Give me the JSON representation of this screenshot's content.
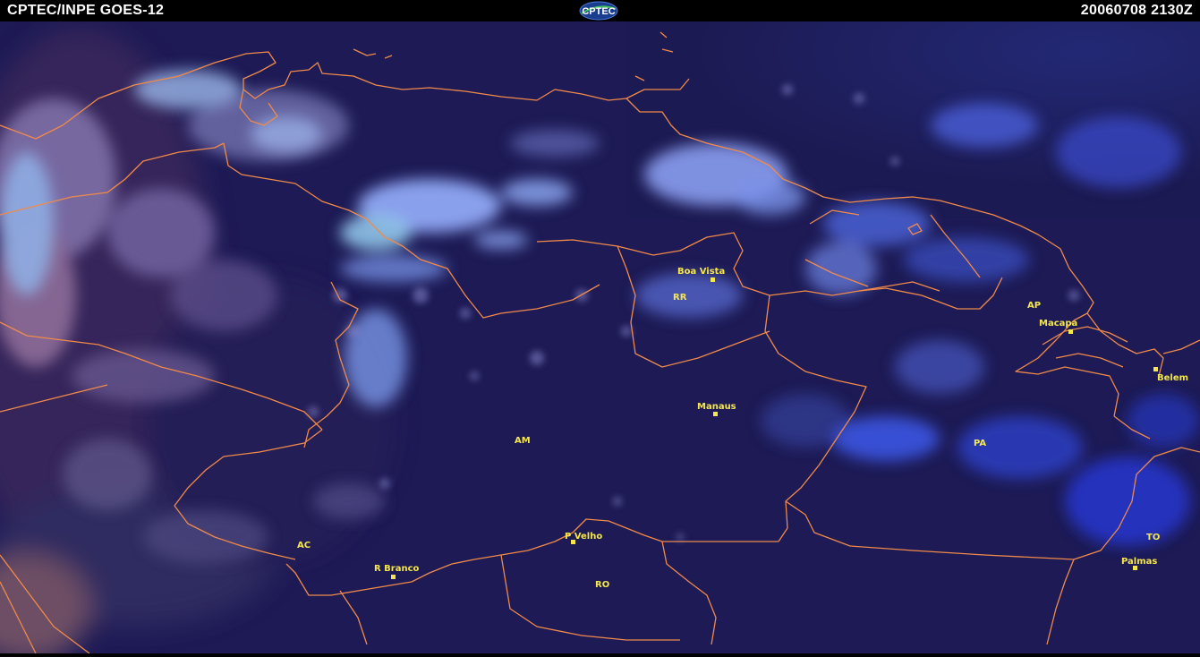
{
  "header": {
    "title": "CPTEC/INPE GOES-12",
    "timestamp": "20060708 2130Z",
    "logo_text": "CPTEC"
  },
  "map": {
    "states": [
      {
        "key": "rr",
        "label": "RR"
      },
      {
        "key": "am",
        "label": "AM"
      },
      {
        "key": "ap",
        "label": "AP"
      },
      {
        "key": "pa",
        "label": "PA"
      },
      {
        "key": "ac",
        "label": "AC"
      },
      {
        "key": "ro",
        "label": "RO"
      },
      {
        "key": "to",
        "label": "TO"
      }
    ],
    "cities": [
      {
        "key": "boa-vista",
        "label": "Boa Vista"
      },
      {
        "key": "macapa",
        "label": "Macapa"
      },
      {
        "key": "belem",
        "label": "Belem"
      },
      {
        "key": "manaus",
        "label": "Manaus"
      },
      {
        "key": "p-velho",
        "label": "P Velho"
      },
      {
        "key": "r-branco",
        "label": "R Branco"
      },
      {
        "key": "palmas",
        "label": "Palmas"
      }
    ],
    "colors": {
      "background": "#1d1a55",
      "border": "#f08a4a",
      "label": "#f4e64c",
      "cloud_high": "#7f9cf2",
      "cloud_low": "#a87aa8"
    }
  }
}
